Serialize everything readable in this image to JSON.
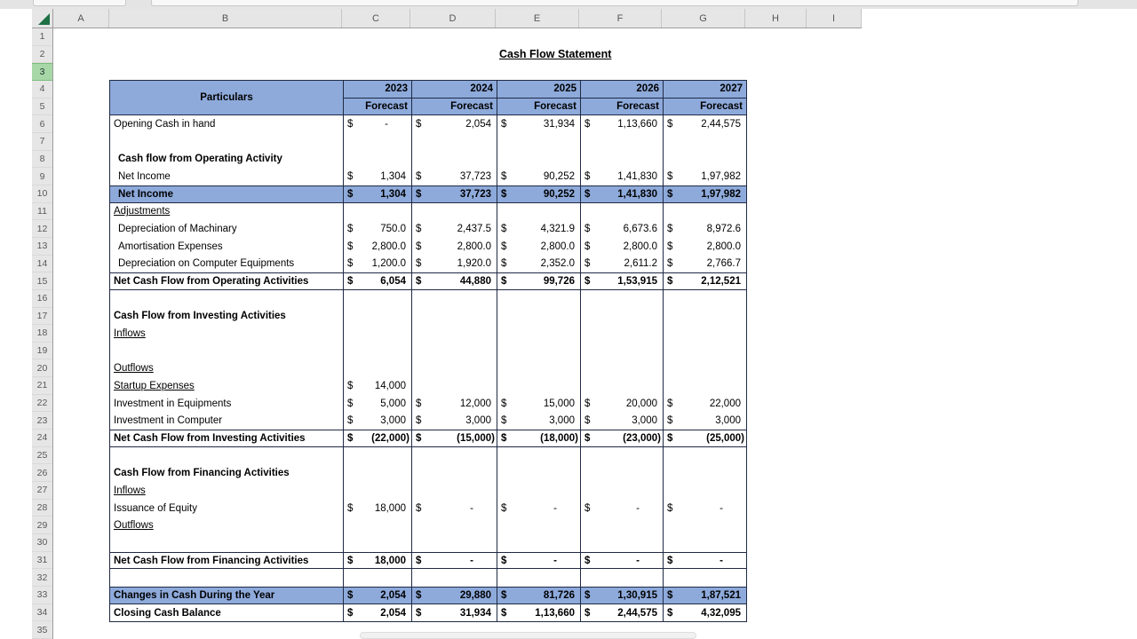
{
  "app": {
    "column_letters": [
      "A",
      "B",
      "C",
      "D",
      "E",
      "F",
      "G",
      "H",
      "I"
    ],
    "row_numbers": [
      "1",
      "2",
      "3",
      "4",
      "5",
      "6",
      "7",
      "8",
      "9",
      "10",
      "11",
      "12",
      "13",
      "14",
      "15",
      "16",
      "17",
      "18",
      "19",
      "20",
      "21",
      "22",
      "23",
      "24",
      "25",
      "26",
      "27",
      "28",
      "29",
      "30",
      "31",
      "32",
      "33",
      "34",
      "35"
    ],
    "selected_row": "3"
  },
  "sheet": {
    "title": "Cash Flow Statement",
    "table": {
      "header": {
        "particulars": "Particulars",
        "years": [
          "2023",
          "2024",
          "2025",
          "2026",
          "2027"
        ],
        "forecast_label": "Forecast"
      },
      "currency_symbol": "$",
      "rows": [
        {
          "row": "6",
          "label": "Opening Cash in hand",
          "flags": [],
          "values": [
            "-",
            "2,054",
            "31,934",
            "1,13,660",
            "2,44,575"
          ]
        },
        {
          "row": "7",
          "label": "",
          "flags": [],
          "values": null
        },
        {
          "row": "8",
          "label": "Cash flow from Operating Activity",
          "flags": [
            "bold",
            "indent"
          ],
          "values": null
        },
        {
          "row": "9",
          "label": "Net Income",
          "flags": [
            "indent"
          ],
          "values": [
            "1,304",
            "37,723",
            "90,252",
            "1,41,830",
            "1,97,982"
          ]
        },
        {
          "row": "10",
          "label": "Net Income",
          "flags": [
            "bold",
            "blue",
            "rule",
            "indent"
          ],
          "values": [
            "1,304",
            "37,723",
            "90,252",
            "1,41,830",
            "1,97,982"
          ]
        },
        {
          "row": "11",
          "label": "Adjustments",
          "flags": [
            "underline"
          ],
          "values": null
        },
        {
          "row": "12",
          "label": "Depreciation of Machinary",
          "flags": [
            "indent"
          ],
          "values": [
            "750.0",
            "2,437.5",
            "4,321.9",
            "6,673.6",
            "8,972.6"
          ]
        },
        {
          "row": "13",
          "label": "Amortisation Expenses",
          "flags": [
            "indent"
          ],
          "values": [
            "2,800.0",
            "2,800.0",
            "2,800.0",
            "2,800.0",
            "2,800.0"
          ]
        },
        {
          "row": "14",
          "label": "Depreciation on Computer Equipments",
          "flags": [
            "indent"
          ],
          "values": [
            "1,200.0",
            "1,920.0",
            "2,352.0",
            "2,611.2",
            "2,766.7"
          ]
        },
        {
          "row": "15",
          "label": "Net Cash Flow from Operating Activities",
          "flags": [
            "bold",
            "rule"
          ],
          "values": [
            "6,054",
            "44,880",
            "99,726",
            "1,53,915",
            "2,12,521"
          ]
        },
        {
          "row": "16",
          "label": "",
          "flags": [],
          "values": null
        },
        {
          "row": "17",
          "label": "Cash Flow from Investing Activities",
          "flags": [
            "bold"
          ],
          "values": null
        },
        {
          "row": "18",
          "label": "Inflows",
          "flags": [
            "underline"
          ],
          "values": null
        },
        {
          "row": "19",
          "label": "",
          "flags": [],
          "values": null
        },
        {
          "row": "20",
          "label": "Outflows",
          "flags": [
            "underline"
          ],
          "values": null
        },
        {
          "row": "21",
          "label": "Startup Expenses",
          "flags": [
            "underline"
          ],
          "values": [
            "14,000",
            null,
            null,
            null,
            null
          ]
        },
        {
          "row": "22",
          "label": "Investment in Equipments",
          "flags": [],
          "values": [
            "5,000",
            "12,000",
            "15,000",
            "20,000",
            "22,000"
          ]
        },
        {
          "row": "23",
          "label": "Investment in Computer",
          "flags": [],
          "values": [
            "3,000",
            "3,000",
            "3,000",
            "3,000",
            "3,000"
          ]
        },
        {
          "row": "24",
          "label": "Net Cash Flow from Investing Activities",
          "flags": [
            "bold",
            "rule"
          ],
          "values": [
            "(22,000)",
            "(15,000)",
            "(18,000)",
            "(23,000)",
            "(25,000)"
          ]
        },
        {
          "row": "25",
          "label": "",
          "flags": [],
          "values": null
        },
        {
          "row": "26",
          "label": "Cash Flow from Financing Activities",
          "flags": [
            "bold"
          ],
          "values": null
        },
        {
          "row": "27",
          "label": "Inflows",
          "flags": [
            "underline"
          ],
          "values": null
        },
        {
          "row": "28",
          "label": "Issuance of Equity",
          "flags": [],
          "values": [
            "18,000",
            "-",
            "-",
            "-",
            "-"
          ]
        },
        {
          "row": "29",
          "label": "Outflows",
          "flags": [
            "underline"
          ],
          "values": null
        },
        {
          "row": "30",
          "label": "",
          "flags": [],
          "values": null
        },
        {
          "row": "31",
          "label": "Net Cash Flow from Financing Activities",
          "flags": [
            "bold",
            "rule"
          ],
          "values": [
            "18,000",
            "-",
            "-",
            "-",
            "-"
          ]
        },
        {
          "row": "32",
          "label": "",
          "flags": [],
          "values": null
        },
        {
          "row": "33",
          "label": "Changes in Cash During the Year",
          "flags": [
            "bold",
            "blue",
            "rule"
          ],
          "values": [
            "2,054",
            "29,880",
            "81,726",
            "1,30,915",
            "1,87,521"
          ]
        },
        {
          "row": "34",
          "label": "Closing Cash Balance",
          "flags": [
            "bold"
          ],
          "values": [
            "2,054",
            "31,934",
            "1,13,660",
            "2,44,575",
            "4,32,095"
          ]
        }
      ]
    }
  },
  "colors": {
    "table_header_fill": "#8EAADB",
    "highlight_row_fill": "#8EAADB",
    "table_border": "#1F2A44",
    "chrome_gray": "#E7E6E6",
    "selected_row_header_fill": "#A7D7A7",
    "select_all_triangle_green": "#1E7145"
  }
}
